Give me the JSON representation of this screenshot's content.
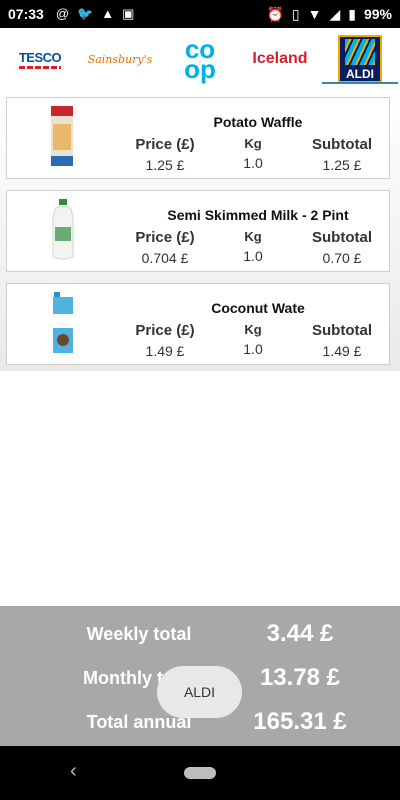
{
  "status_bar": {
    "time": "07:33",
    "battery": "99%"
  },
  "tabs": [
    {
      "label": "TESCO"
    },
    {
      "label": "Sainsbury's"
    },
    {
      "label_line1": "co",
      "label_line2": "op"
    },
    {
      "label": "Iceland"
    },
    {
      "label": "ALDI",
      "active": true
    }
  ],
  "headers": {
    "price": "Price (£)",
    "kg": "Kg",
    "subtotal": "Subtotal"
  },
  "products": [
    {
      "name": "Potato Waffle",
      "price": "1.25 £",
      "kg": "1.0",
      "subtotal": "1.25 £"
    },
    {
      "name": "Semi Skimmed Milk - 2 Pint",
      "price": "0.704 £",
      "kg": "1.0",
      "subtotal": "0.70 £"
    },
    {
      "name": "Coconut Wate",
      "price": "1.49 £",
      "kg": "1.0",
      "subtotal": "1.49 £"
    }
  ],
  "totals": {
    "weekly_label": "Weekly total",
    "weekly_value": "3.44 £",
    "monthly_label": "Monthly total",
    "monthly_value": "13.78 £",
    "annual_label": "Total annual",
    "annual_value": "165.31 £"
  },
  "toast": "ALDI",
  "colors": {
    "footer": "#a8a8a8",
    "aldi_blue": "#0b1c5f",
    "coop_blue": "#00b1e7",
    "iceland_red": "#d2212e"
  }
}
